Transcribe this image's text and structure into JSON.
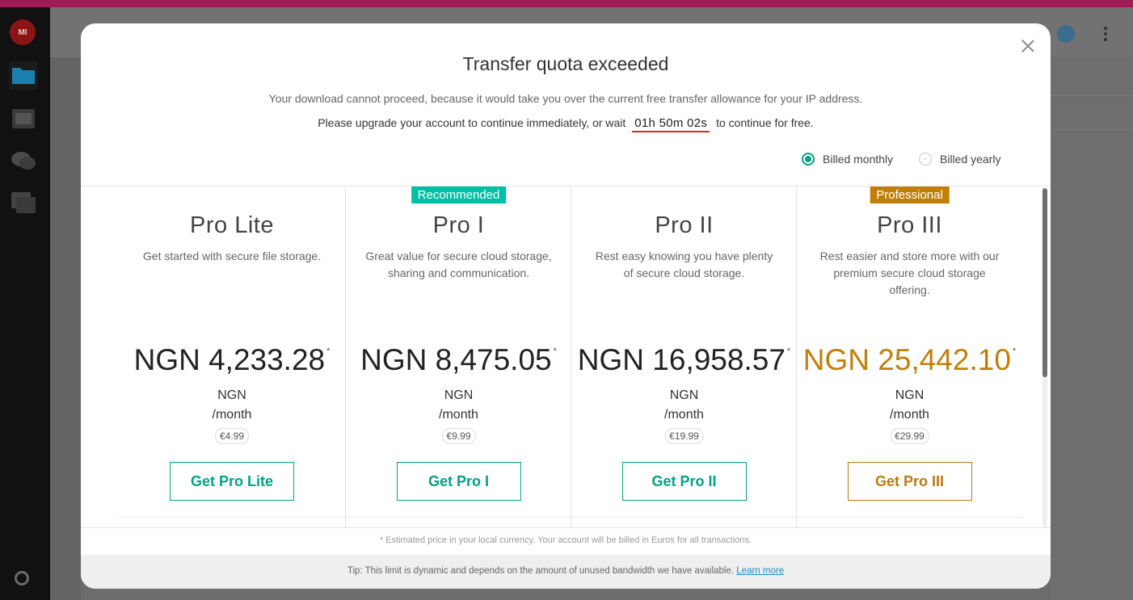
{
  "background": {
    "avatar_initials": "MI",
    "sidebar_items": [
      "cloud-drive-icon",
      "photos-icon",
      "chat-icon",
      "contacts-icon"
    ]
  },
  "modal": {
    "title": "Transfer quota exceeded",
    "message": "Your download cannot proceed, because it would take you over the current free transfer allowance for your IP address.",
    "wait_prefix": "Please upgrade your account to continue immediately, or wait",
    "timer": "01h 50m 02s",
    "wait_suffix": "to continue for free.",
    "billing": {
      "monthly_label": "Billed monthly",
      "yearly_label": "Billed yearly",
      "selected": "monthly"
    },
    "plans": [
      {
        "name": "Pro Lite",
        "badge": "",
        "description": "Get started with secure file storage.",
        "price": "NGN 4,233.28",
        "asterisk": "*",
        "currency": "NGN",
        "period": "/month",
        "eur_price": "€4.99",
        "button": "Get Pro Lite",
        "accent": "#00a382"
      },
      {
        "name": "Pro I",
        "badge": "Recommended",
        "description": "Great value for secure cloud storage, sharing and communication.",
        "price": "NGN 8,475.05",
        "asterisk": "*",
        "currency": "NGN",
        "period": "/month",
        "eur_price": "€9.99",
        "button": "Get Pro I",
        "accent": "#00a382"
      },
      {
        "name": "Pro II",
        "badge": "",
        "description": "Rest easy knowing you have plenty of secure cloud storage.",
        "price": "NGN 16,958.57",
        "asterisk": "*",
        "currency": "NGN",
        "period": "/month",
        "eur_price": "€19.99",
        "button": "Get Pro II",
        "accent": "#00a382"
      },
      {
        "name": "Pro III",
        "badge": "Professional",
        "description": "Rest easier and store more with our premium secure cloud storage offering.",
        "price": "NGN 25,442.10",
        "asterisk": "*",
        "currency": "NGN",
        "period": "/month",
        "eur_price": "€29.99",
        "button": "Get Pro III",
        "accent": "#bb7a0f"
      }
    ],
    "colors": {
      "recommended_badge": "#00bfa5",
      "professional_badge": "#c17f0a",
      "pro3_price": "#c17f0a"
    },
    "footnote": "* Estimated price in your local currency. Your account will be billed in Euros for all transactions.",
    "tip_text": "Tip: This limit is dynamic and depends on the amount of unused bandwidth we have available.",
    "tip_link": "Learn more"
  }
}
